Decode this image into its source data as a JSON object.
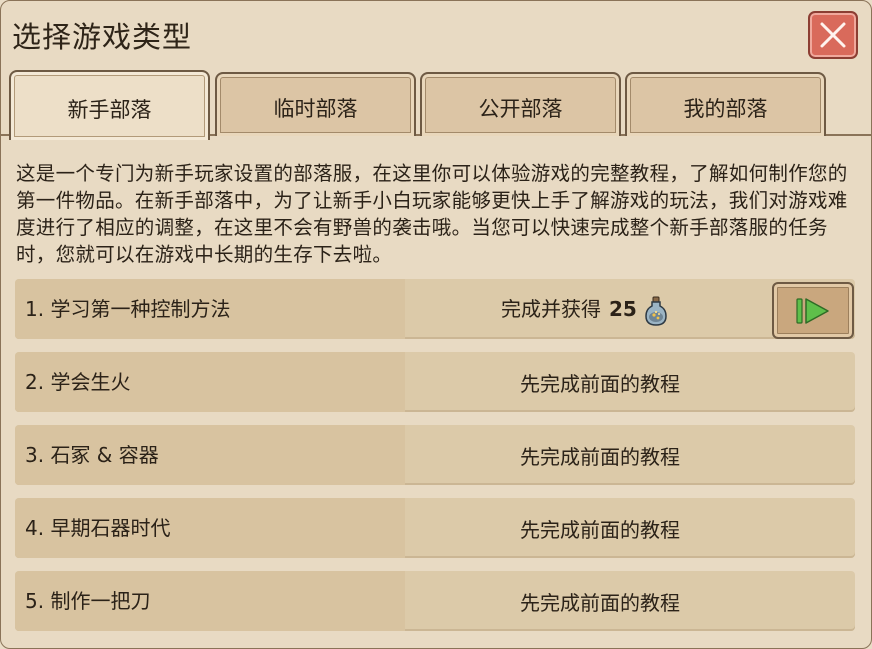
{
  "window": {
    "title": "选择游戏类型"
  },
  "tabs": [
    {
      "label": "新手部落",
      "active": true
    },
    {
      "label": "临时部落",
      "active": false
    },
    {
      "label": "公开部落",
      "active": false
    },
    {
      "label": "我的部落",
      "active": false
    }
  ],
  "description": "这是一个专门为新手玩家设置的部落服，在这里你可以体验游戏的完整教程，了解如何制作您的第一件物品。在新手部落中，为了让新手小白玩家能够更快上手了解游戏的玩法，我们对游戏难度进行了相应的调整，在这里不会有野兽的袭击哦。当您可以快速完成整个新手部落服的任务时，您就可以在游戏中长期的生存下去啦。",
  "tutorials": [
    {
      "name": "1. 学习第一种控制方法",
      "status": "完成并获得",
      "reward": "25",
      "reward_icon": "potion-icon"
    },
    {
      "name": "2. 学会生火",
      "status": "先完成前面的教程"
    },
    {
      "name": "3. 石冢 & 容器",
      "status": "先完成前面的教程"
    },
    {
      "name": "4. 早期石器时代",
      "status": "先完成前面的教程"
    },
    {
      "name": "5. 制作一把刀",
      "status": "先完成前面的教程"
    }
  ],
  "colors": {
    "background": "#e8dac3",
    "close_button": "#d96a5b",
    "play_arrow": "#5fbf4a",
    "tab": "#dcc5a5",
    "row": "#dccaa9"
  }
}
